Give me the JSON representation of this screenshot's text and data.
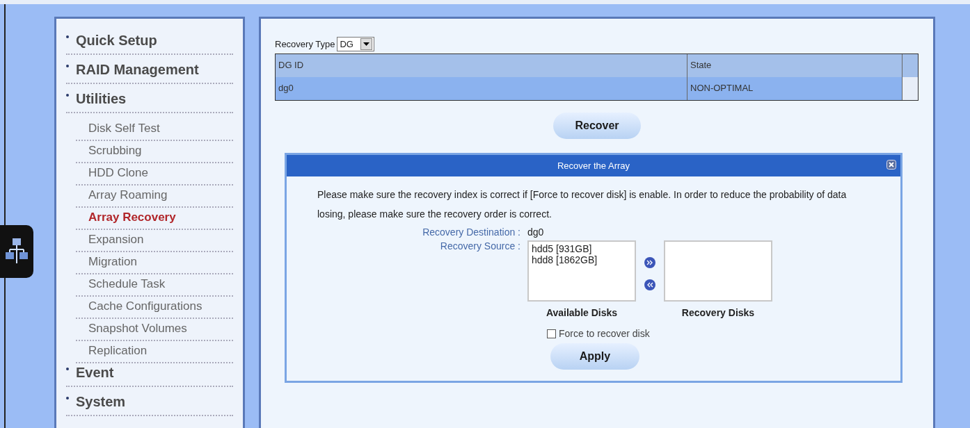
{
  "sidebar": {
    "items": [
      {
        "label": "Quick Setup",
        "selected": false
      },
      {
        "label": "RAID Management",
        "selected": false
      },
      {
        "label": "Utilities",
        "selected": false,
        "children": [
          {
            "label": "Disk Self Test",
            "selected": false
          },
          {
            "label": "Scrubbing",
            "selected": false
          },
          {
            "label": "HDD Clone",
            "selected": false
          },
          {
            "label": "Array Roaming",
            "selected": false
          },
          {
            "label": "Array Recovery",
            "selected": true
          },
          {
            "label": "Expansion",
            "selected": false
          },
          {
            "label": "Migration",
            "selected": false
          },
          {
            "label": "Schedule Task",
            "selected": false
          },
          {
            "label": "Cache Configurations",
            "selected": false
          },
          {
            "label": "Snapshot Volumes",
            "selected": false
          },
          {
            "label": "Replication",
            "selected": false
          }
        ]
      },
      {
        "label": "Event",
        "selected": false
      },
      {
        "label": "System",
        "selected": false
      }
    ]
  },
  "recovery_type": {
    "label": "Recovery Type",
    "value": "DG"
  },
  "table": {
    "columns": [
      "DG ID",
      "State"
    ],
    "rows": [
      {
        "cells": [
          "dg0",
          "NON-OPTIMAL"
        ],
        "selected": true
      }
    ]
  },
  "recover_button": "Recover",
  "dialog": {
    "title": "Recover the Array",
    "message": "Please make sure the recovery index is correct if [Force to recover disk] is enable. In order to reduce the probability of data losing, please make sure the recovery order is correct.",
    "destination_label": "Recovery Destination :",
    "destination_value": "dg0",
    "source_label": "Recovery Source :",
    "available_disks": [
      "hdd5 [931GB]",
      "hdd8 [1862GB]"
    ],
    "available_caption": "Available Disks",
    "recovery_caption": "Recovery Disks",
    "force": {
      "label": "Force to recover disk",
      "checked": false
    },
    "apply_button": "Apply"
  }
}
